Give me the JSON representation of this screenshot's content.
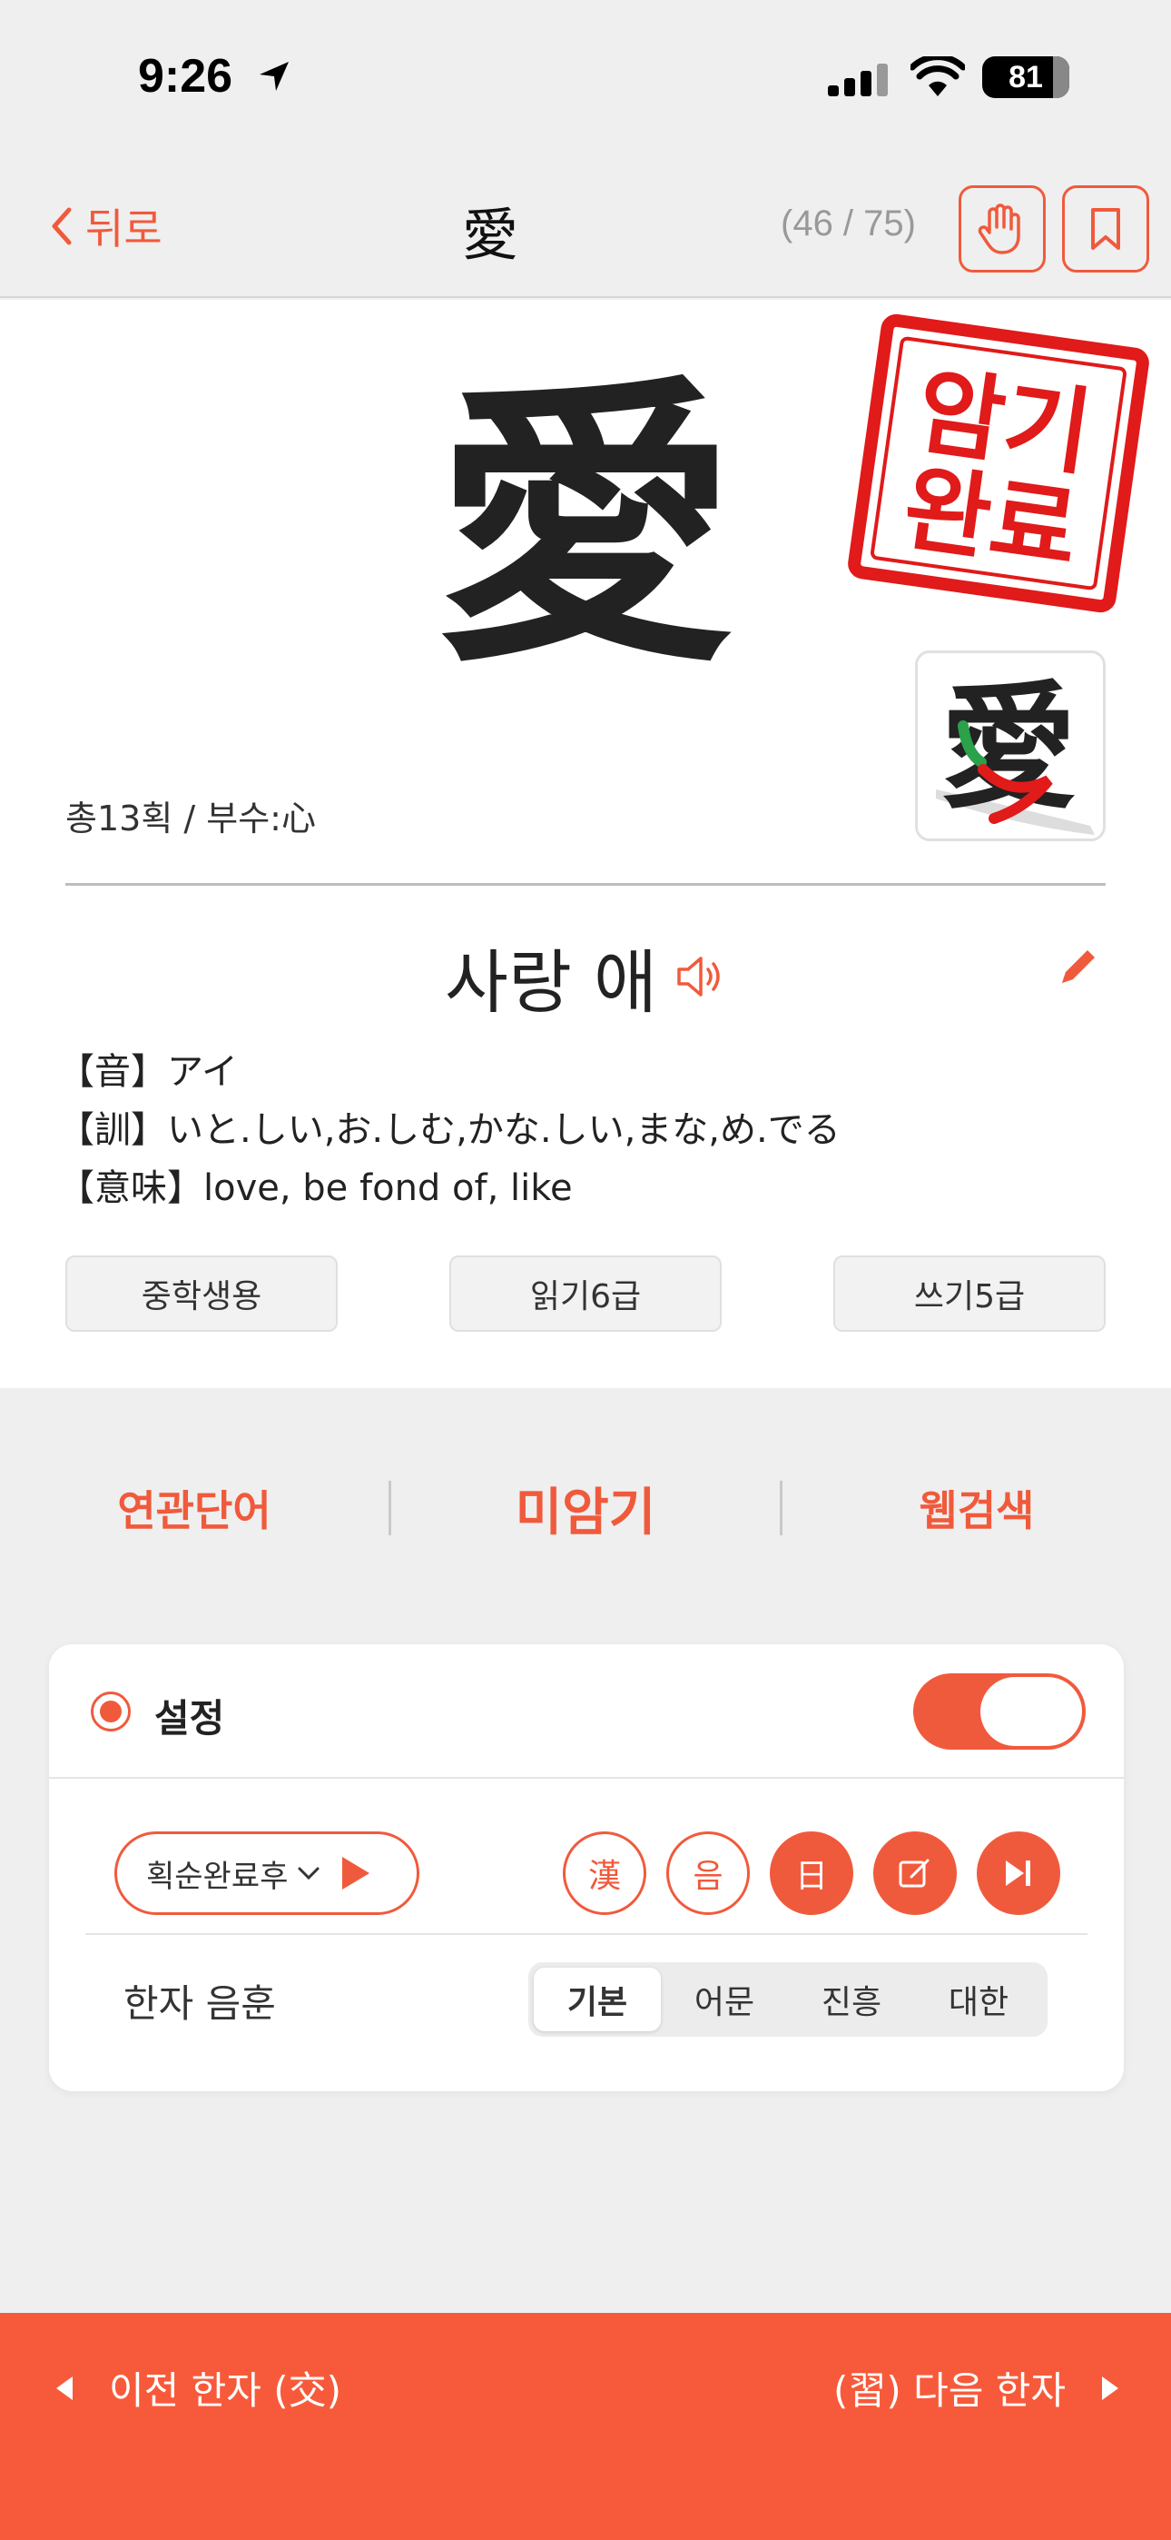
{
  "status": {
    "time": "9:26",
    "battery": "81"
  },
  "nav": {
    "back_label": "뒤로",
    "title": "愛",
    "counter": "(46 / 75)"
  },
  "character": {
    "glyph": "愛",
    "stamp_lines": [
      "암기",
      "완료"
    ],
    "strokes": "총13획 / 부수:心",
    "meaning": "사랑 애",
    "on_reading": "【音】アイ",
    "kun_reading": "【訓】いと.しい,お.しむ,かな.しい,まな,め.でる",
    "definition": "【意味】love, be fond of, like",
    "tags": [
      "중학생용",
      "읽기6급",
      "쓰기5급"
    ]
  },
  "actions": {
    "related": "연관단어",
    "unmemorized": "미암기",
    "web_search": "웹검색"
  },
  "settings": {
    "label": "설정",
    "dropdown_value": "획순완료후",
    "buttons": [
      "漢",
      "음",
      "日"
    ],
    "reading_label": "한자 음훈",
    "segments": [
      "기본",
      "어문",
      "진흥",
      "대한"
    ]
  },
  "bottom": {
    "prev": "이전 한자 (交)",
    "next": "(習) 다음 한자"
  },
  "colors": {
    "accent": "#f05a3c",
    "bottom_bar": "#f75a3a"
  }
}
